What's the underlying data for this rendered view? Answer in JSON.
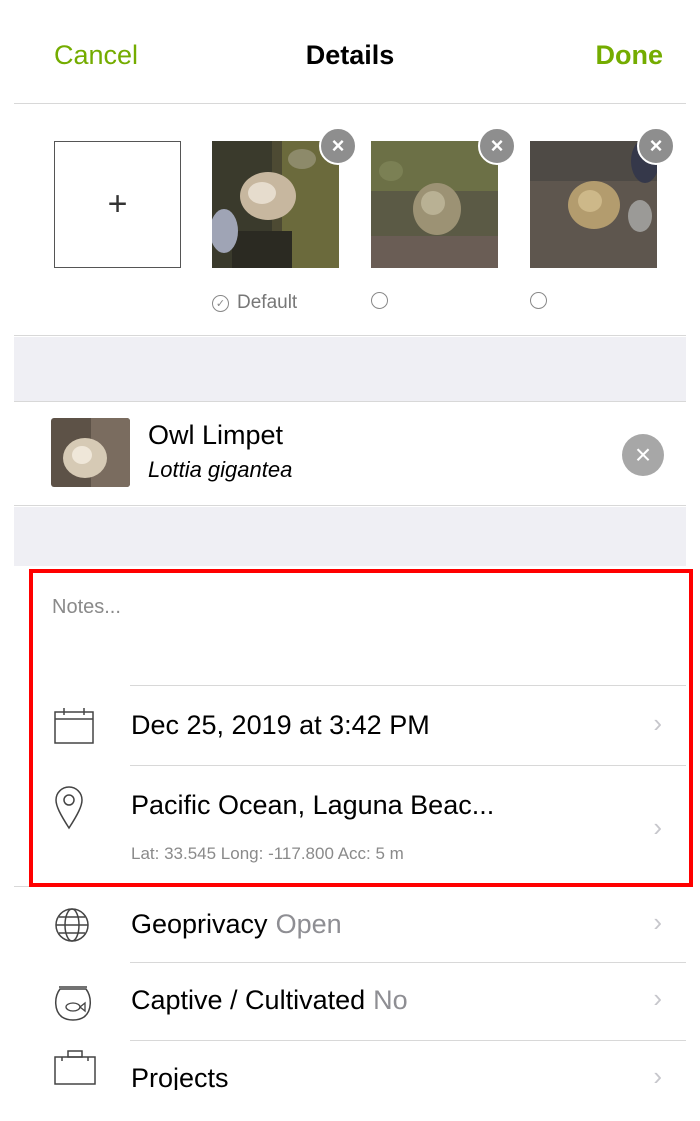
{
  "nav": {
    "cancel": "Cancel",
    "title": "Details",
    "done": "Done"
  },
  "photos": {
    "add_symbol": "+",
    "remove_symbol": "×",
    "default_label": "Default",
    "check_symbol": "✓"
  },
  "taxon": {
    "common_name": "Owl Limpet",
    "scientific_name": "Lottia gigantea",
    "clear_symbol": "×"
  },
  "notes": {
    "placeholder": "Notes..."
  },
  "rows": {
    "date": {
      "label": "Dec 25, 2019 at 3:42 PM"
    },
    "location": {
      "label": "Pacific Ocean, Laguna Beac...",
      "sub": "Lat: 33.545  Long: -117.800  Acc: 5 m"
    },
    "geoprivacy": {
      "label": "Geoprivacy",
      "value": "Open"
    },
    "captive": {
      "label": "Captive / Cultivated",
      "value": "No"
    },
    "projects": {
      "label": "Projects"
    }
  },
  "chevron": "›",
  "colors": {
    "accent": "#74ac00",
    "highlight": "#ff0000",
    "band": "#efeff4"
  }
}
